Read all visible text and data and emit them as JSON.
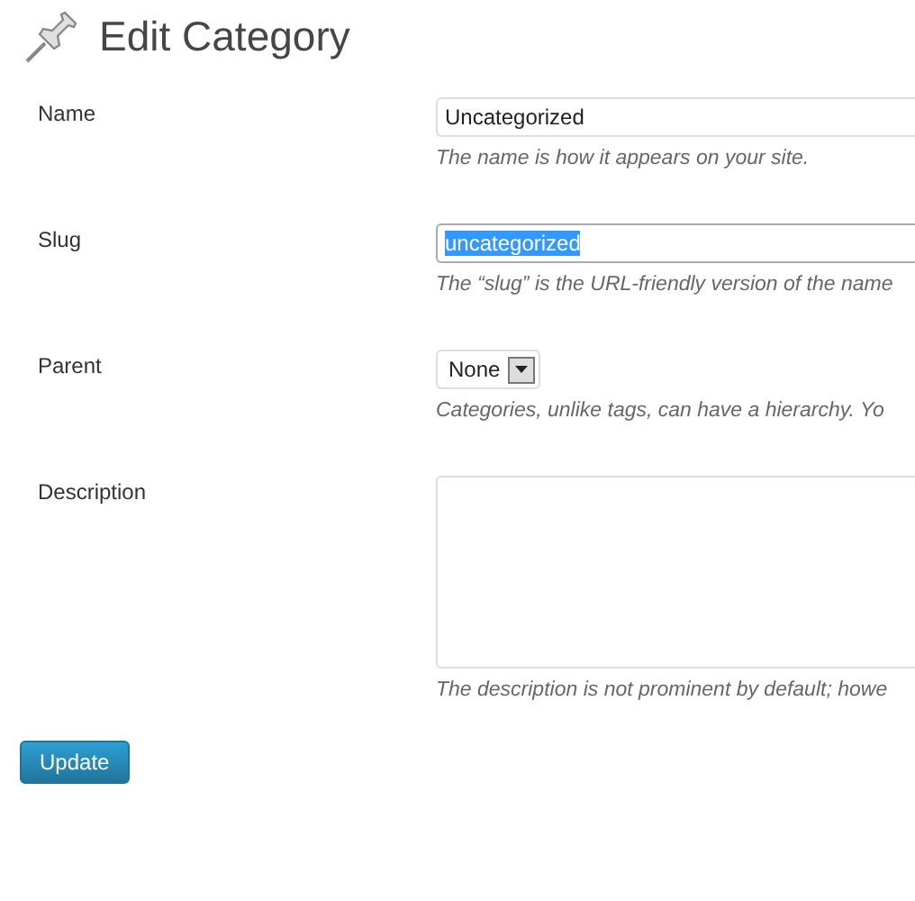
{
  "title": "Edit Category",
  "fields": [
    {
      "kind": "text",
      "label": "Name",
      "value": "Uncategorized",
      "text_selected": false,
      "hint": "The name is how it appears on your site."
    },
    {
      "kind": "text",
      "label": "Slug",
      "value": "uncategorized",
      "text_selected": true,
      "hint": "The “slug” is the URL-friendly version of the name"
    },
    {
      "kind": "select",
      "label": "Parent",
      "value": "None",
      "hint": "Categories, unlike tags, can have a hierarchy. Yo"
    },
    {
      "kind": "textarea",
      "label": "Description",
      "hint": "The description is not prominent by default; howe"
    }
  ],
  "button": "Update"
}
